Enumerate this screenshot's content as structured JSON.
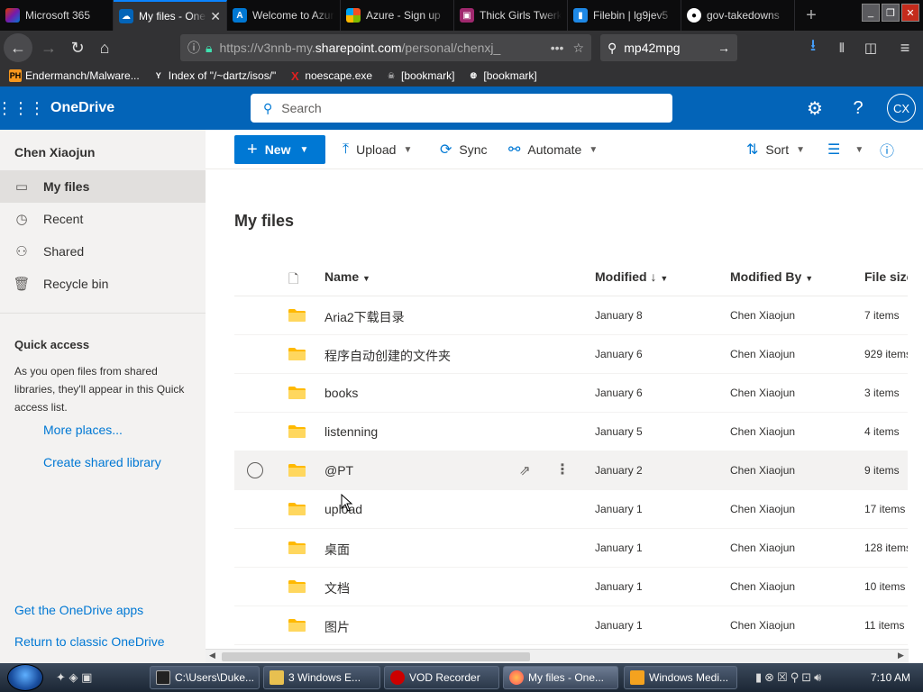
{
  "browser": {
    "tabs": [
      {
        "title": "Microsoft 365",
        "active": false
      },
      {
        "title": "My files - OneDrive",
        "active": true
      },
      {
        "title": "Welcome to Azure",
        "active": false
      },
      {
        "title": "Azure - Sign up",
        "active": false
      },
      {
        "title": "Thick Girls Twerking",
        "active": false
      },
      {
        "title": "Filebin | lg9jev5",
        "active": false
      },
      {
        "title": "gov-takedowns",
        "active": false
      }
    ],
    "url_prefix": "https://v3nnb-my.",
    "url_domain": "sharepoint.com",
    "url_path": "/personal/chenxj_",
    "search_value": "mp42mpg",
    "bookmarks": [
      {
        "label": "Endermanch/Malware...",
        "icon": "PH"
      },
      {
        "label": "Index of \"/~dartz/isos/\"",
        "icon": "Y"
      },
      {
        "label": "noescape.exe",
        "icon": "X"
      },
      {
        "label": "[bookmark]",
        "icon": "skull-icon"
      },
      {
        "label": "[bookmark]",
        "icon": "globe-icon"
      }
    ]
  },
  "suite": {
    "app_name": "OneDrive",
    "search_placeholder": "Search",
    "avatar_initials": "CX",
    "accent": "#0364b8"
  },
  "leftnav": {
    "user_name": "Chen Xiaojun",
    "items": [
      {
        "label": "My files",
        "icon": "folder-icon",
        "active": true
      },
      {
        "label": "Recent",
        "icon": "clock-icon",
        "active": false
      },
      {
        "label": "Shared",
        "icon": "people-icon",
        "active": false
      },
      {
        "label": "Recycle bin",
        "icon": "trash-icon",
        "active": false
      }
    ],
    "quick_access_title": "Quick access",
    "quick_access_desc": "As you open files from shared libraries, they'll appear in this Quick access list.",
    "more_places": "More places...",
    "create_shared": "Create shared library",
    "get_apps": "Get the OneDrive apps",
    "return_classic": "Return to classic OneDrive"
  },
  "commandbar": {
    "new_label": "New",
    "upload_label": "Upload",
    "sync_label": "Sync",
    "automate_label": "Automate",
    "sort_label": "Sort"
  },
  "main": {
    "title": "My files",
    "columns": {
      "name": "Name",
      "modified": "Modified",
      "modified_by": "Modified By",
      "file_size": "File size"
    },
    "rows": [
      {
        "name": "Aria2下载目录",
        "modified": "January 8",
        "modified_by": "Chen Xiaojun",
        "size": "7 items"
      },
      {
        "name": "程序自动创建的文件夹",
        "modified": "January 6",
        "modified_by": "Chen Xiaojun",
        "size": "929 items"
      },
      {
        "name": "books",
        "modified": "January 6",
        "modified_by": "Chen Xiaojun",
        "size": "3 items"
      },
      {
        "name": "listenning",
        "modified": "January 5",
        "modified_by": "Chen Xiaojun",
        "size": "4 items"
      },
      {
        "name": "@PT",
        "modified": "January 2",
        "modified_by": "Chen Xiaojun",
        "size": "9 items"
      },
      {
        "name": "upload",
        "modified": "January 1",
        "modified_by": "Chen Xiaojun",
        "size": "17 items"
      },
      {
        "name": "桌面",
        "modified": "January 1",
        "modified_by": "Chen Xiaojun",
        "size": "128 items"
      },
      {
        "name": "文档",
        "modified": "January 1",
        "modified_by": "Chen Xiaojun",
        "size": "10 items"
      },
      {
        "name": "图片",
        "modified": "January 1",
        "modified_by": "Chen Xiaojun",
        "size": "11 items"
      }
    ]
  },
  "taskbar": {
    "buttons": [
      {
        "label": "C:\\Users\\Duke..."
      },
      {
        "label": "3 Windows E..."
      },
      {
        "label": "VOD Recorder"
      },
      {
        "label": "My files - One..."
      },
      {
        "label": "Windows Medi..."
      }
    ],
    "clock": "7:10 AM"
  }
}
